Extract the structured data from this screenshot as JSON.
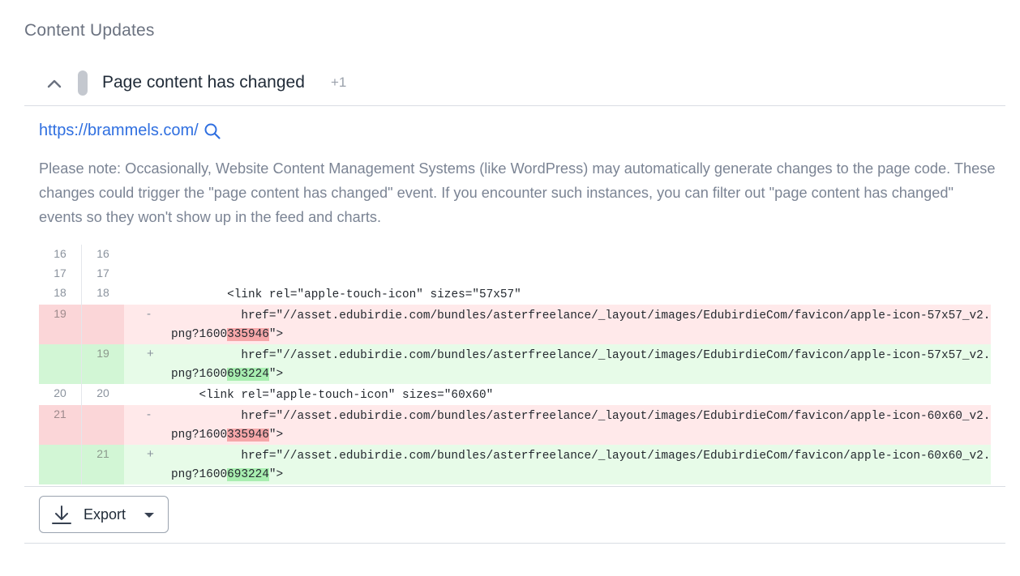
{
  "section": {
    "title": "Content Updates"
  },
  "event": {
    "title": "Page content has changed",
    "count": "+1",
    "url": "https://brammels.com/",
    "note": "Please note: Occasionally, Website Content Management Systems (like WordPress) may automatically generate changes to the page code. These changes could trigger the \"page content has changed\" event. If you encounter such instances, you can filter out \"page content has changed\" events so they won't show up in the feed and charts."
  },
  "diff": {
    "rows": [
      {
        "type": "context",
        "left": "16",
        "right": "16",
        "marker": "",
        "code": ""
      },
      {
        "type": "context",
        "left": "17",
        "right": "17",
        "marker": "",
        "code": ""
      },
      {
        "type": "context",
        "left": "18",
        "right": "18",
        "marker": "",
        "code": "        <link rel=\"apple-touch-icon\" sizes=\"57x57\""
      },
      {
        "type": "del",
        "left": "19",
        "right": "",
        "marker": "-",
        "code_pre": "          href=\"//asset.edubirdie.com/bundles/asterfreelance/_layout/images/EdubirdieCom/favicon/apple-icon-57x57_v2.png?1600",
        "code_hl": "335946",
        "code_post": "\">"
      },
      {
        "type": "add",
        "left": "",
        "right": "19",
        "marker": "+",
        "code_pre": "          href=\"//asset.edubirdie.com/bundles/asterfreelance/_layout/images/EdubirdieCom/favicon/apple-icon-57x57_v2.png?1600",
        "code_hl": "693224",
        "code_post": "\">"
      },
      {
        "type": "context",
        "left": "20",
        "right": "20",
        "marker": "",
        "code": "    <link rel=\"apple-touch-icon\" sizes=\"60x60\""
      },
      {
        "type": "del",
        "left": "21",
        "right": "",
        "marker": "-",
        "code_pre": "          href=\"//asset.edubirdie.com/bundles/asterfreelance/_layout/images/EdubirdieCom/favicon/apple-icon-60x60_v2.png?1600",
        "code_hl": "335946",
        "code_post": "\">"
      },
      {
        "type": "add",
        "left": "",
        "right": "21",
        "marker": "+",
        "code_pre": "          href=\"//asset.edubirdie.com/bundles/asterfreelance/_layout/images/EdubirdieCom/favicon/apple-icon-60x60_v2.png?1600",
        "code_hl": "693224",
        "code_post": "\">"
      }
    ]
  },
  "footer": {
    "export_label": "Export"
  },
  "icons": {
    "collapse": "chevron-up-icon",
    "search": "search-icon",
    "export": "download-icon",
    "caret": "caret-down-icon"
  },
  "colors": {
    "link": "#2f6fe0",
    "deleted_bg": "#ffe9ea",
    "deleted_highlight": "#f6a7a9",
    "added_bg": "#e7fbe8",
    "added_highlight": "#a8eeb0",
    "status_pill": "#c4c8cf"
  }
}
